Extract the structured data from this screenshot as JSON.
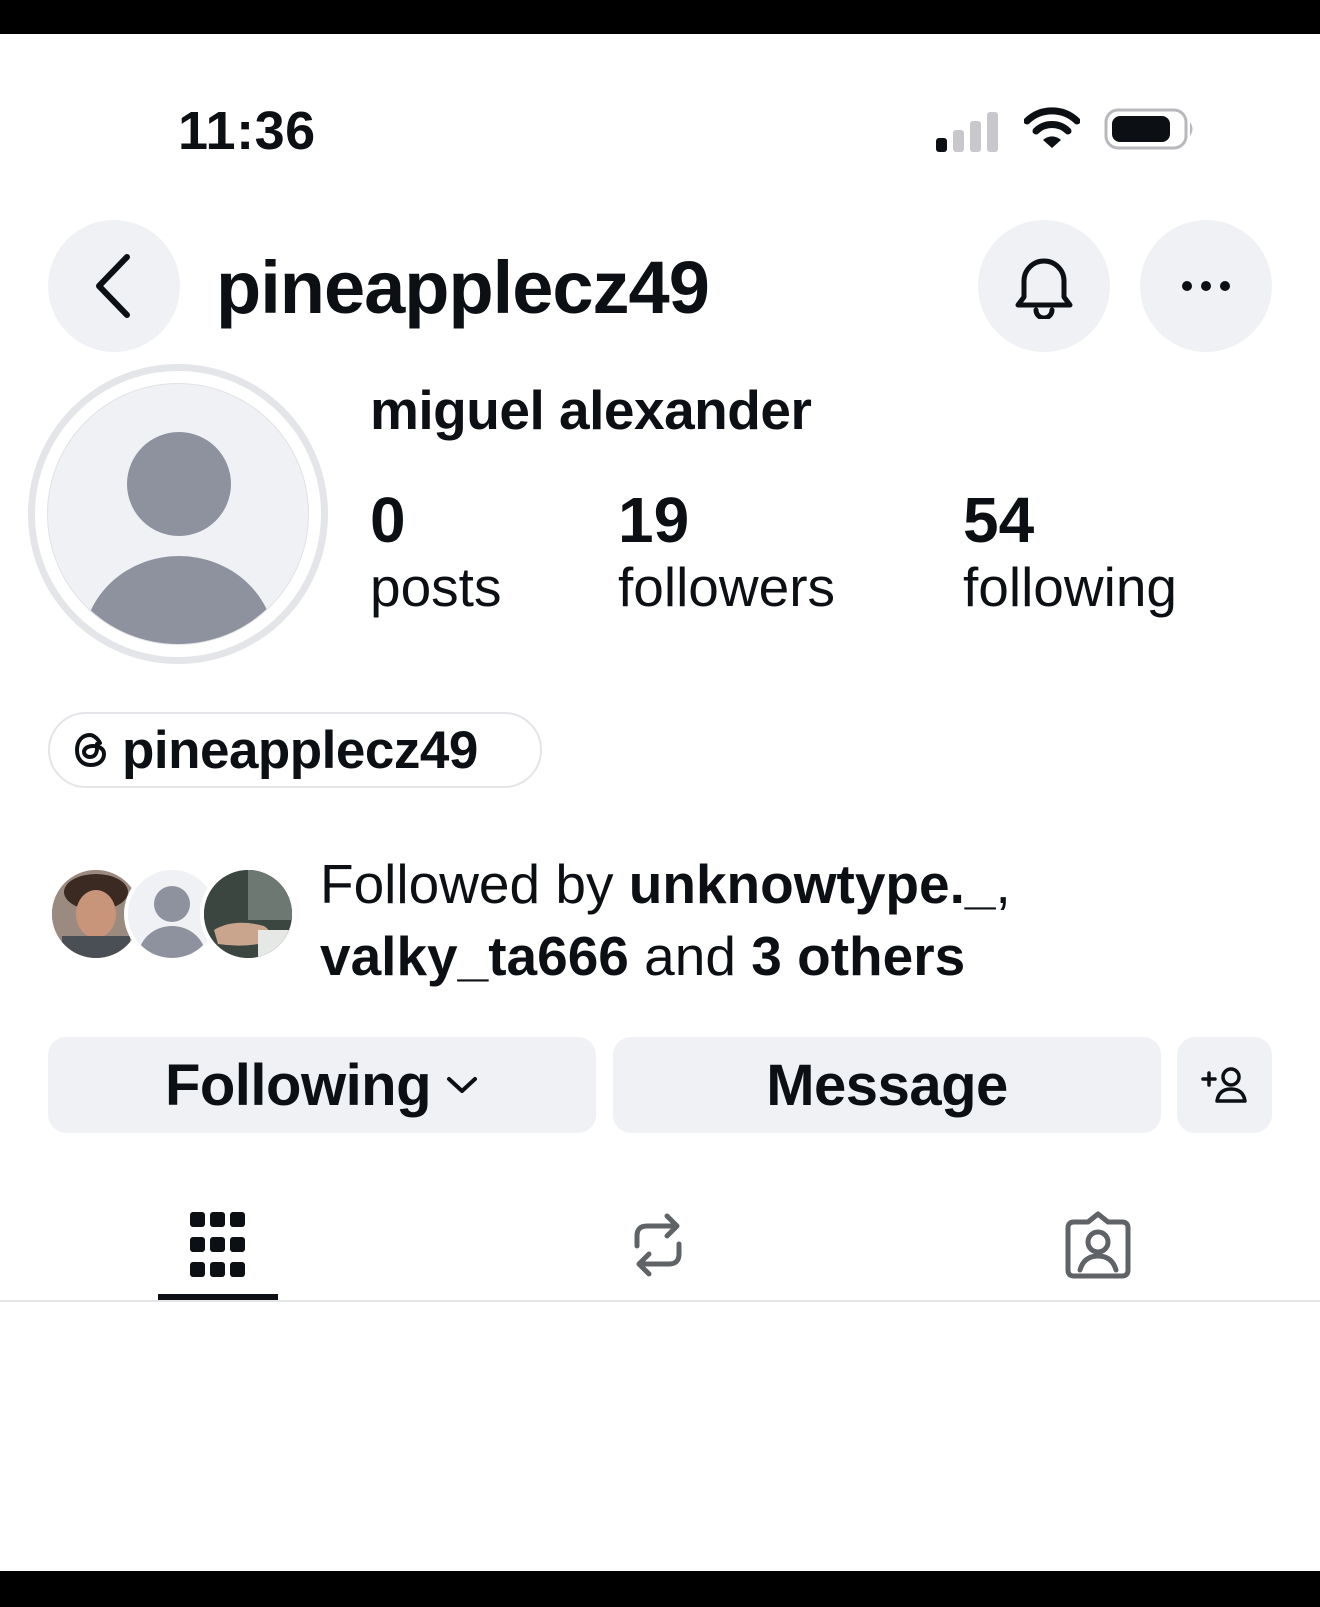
{
  "status_bar": {
    "time": "11:36",
    "signal_icon": "cellular-signal-icon",
    "wifi_icon": "wifi-icon",
    "battery_icon": "battery-icon"
  },
  "header": {
    "username": "pineapplecz49",
    "back_icon": "chevron-left-icon",
    "bell_icon": "bell-icon",
    "more_icon": "ellipsis-icon"
  },
  "profile": {
    "full_name": "miguel alexander",
    "avatar_icon": "default-avatar-icon",
    "stats": [
      {
        "value": "0",
        "label": "posts"
      },
      {
        "value": "19",
        "label": "followers"
      },
      {
        "value": "54",
        "label": "following"
      }
    ],
    "threads_handle": "pineapplecz49",
    "threads_icon": "threads-icon"
  },
  "followed_by": {
    "prefix": "Followed by ",
    "user1": "unknowtype._",
    "separator": ",",
    "user2": "valky_ta666",
    "middle": " and ",
    "others": "3 others"
  },
  "actions": {
    "following_label": "Following",
    "following_icon": "chevron-down-icon",
    "message_label": "Message",
    "add_user_icon": "add-user-icon"
  },
  "tabs": [
    {
      "icon": "grid-icon",
      "active": true
    },
    {
      "icon": "repost-icon",
      "active": false
    },
    {
      "icon": "tagged-icon",
      "active": false
    }
  ],
  "colors": {
    "text": "#0c1014",
    "button_bg": "#eff1f4",
    "avatar_placeholder": "#8e929e",
    "divider": "#e3e5e8"
  }
}
